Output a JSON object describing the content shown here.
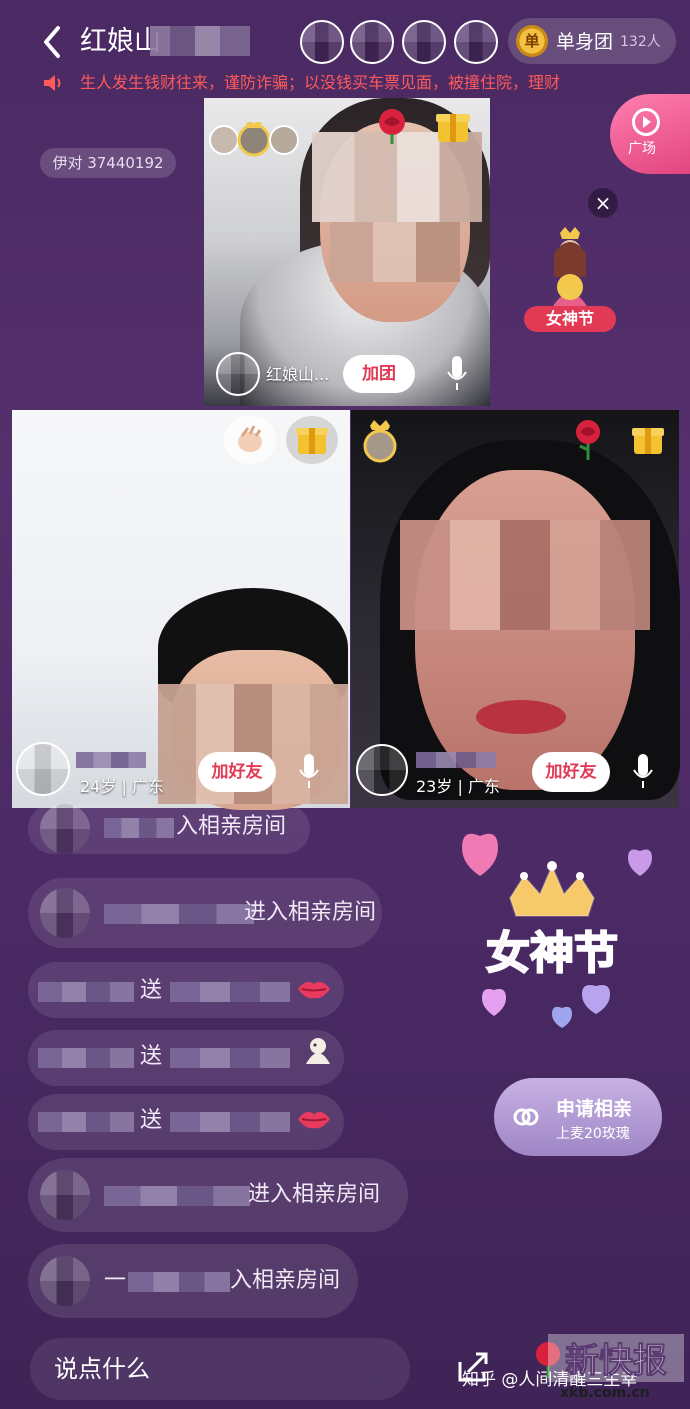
{
  "header": {
    "back_icon": "chevron-left-icon",
    "title": "红娘山",
    "group": {
      "label": "单身团",
      "badge": "单",
      "count": "132人"
    }
  },
  "marquee": {
    "text": "生人发生钱财往来，谨防诈骗；以没钱买车票见面，被撞住院，理财"
  },
  "room": {
    "id": "伊对 37440192"
  },
  "side": {
    "plaza_label": "广场",
    "close": "×",
    "goddess_label": "女神节"
  },
  "host": {
    "name": "红娘山...",
    "join_label": "加团"
  },
  "guests": [
    {
      "info": "24岁 | 广东",
      "add_label": "加好友"
    },
    {
      "info": "23岁 | 广东",
      "add_label": "加好友"
    }
  ],
  "chat": [
    {
      "text": "入相亲房间"
    },
    {
      "text": "进入相亲房间"
    },
    {
      "text": "送"
    },
    {
      "text": "送"
    },
    {
      "text": "送"
    },
    {
      "text": "进入相亲房间"
    },
    {
      "text": "一",
      "text2": "入相亲房间"
    }
  ],
  "promo": {
    "text": "女神节"
  },
  "apply": {
    "title": "申请相亲",
    "subtitle": "上麦20玫瑰"
  },
  "input": {
    "placeholder": "说点什么"
  },
  "watermark": {
    "author": "知乎 @人间清醒三生幸",
    "logo": "新快报",
    "url": "xkb.com.cn"
  }
}
